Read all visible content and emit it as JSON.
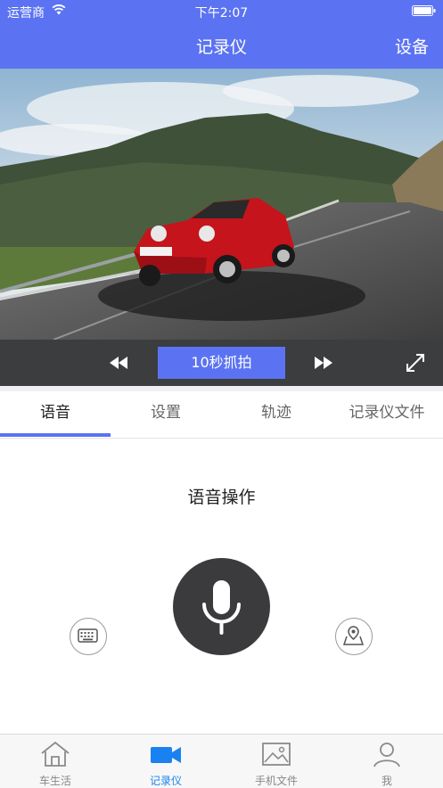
{
  "status_bar": {
    "carrier": "运营商",
    "time": "下午2:07"
  },
  "nav": {
    "title": "记录仪",
    "right_action": "设备"
  },
  "controls": {
    "snapshot_label": "10秒抓拍"
  },
  "tabs": [
    {
      "label": "语音",
      "active": true
    },
    {
      "label": "设置",
      "active": false
    },
    {
      "label": "轨迹",
      "active": false
    },
    {
      "label": "记录仪文件",
      "active": false
    }
  ],
  "voice": {
    "title": "语音操作"
  },
  "tabbar": [
    {
      "label": "车生活",
      "icon": "home-icon",
      "active": false
    },
    {
      "label": "记录仪",
      "icon": "video-camera-icon",
      "active": true
    },
    {
      "label": "手机文件",
      "icon": "image-icon",
      "active": false
    },
    {
      "label": "我",
      "icon": "person-icon",
      "active": false
    }
  ],
  "colors": {
    "accent": "#5b73f2",
    "tabbar_active": "#1a82f0",
    "control_bar": "#3c3d3f",
    "mic": "#3b3b3d"
  }
}
